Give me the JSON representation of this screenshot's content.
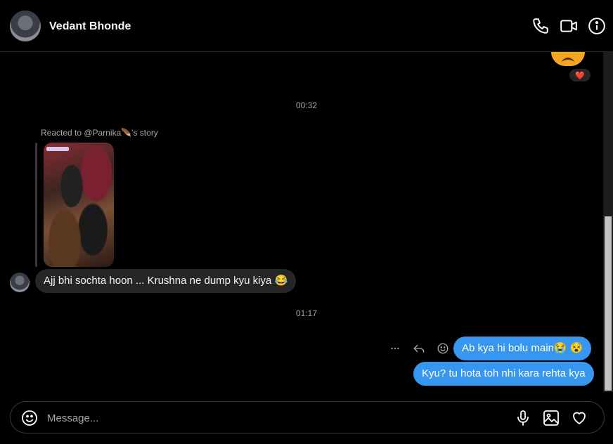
{
  "header": {
    "contact_name": "Vedant Bhonde",
    "icons": [
      "phone-icon",
      "video-camera-icon",
      "info-icon"
    ]
  },
  "thread": {
    "top_reaction": "❤️",
    "time_1": "00:32",
    "story_label": "Reacted to @Parnika🪶's story",
    "incoming_message": "Ajj bhi sochta hoon ... Krushna ne dump kyu kiya 😂",
    "time_2": "01:17",
    "outgoing_messages": [
      "Ab kya hi bolu main😭 😵",
      "Kyu? tu hota toh nhi kara rehta kya"
    ],
    "message_actions": [
      "more-icon",
      "reply-icon",
      "react-icon"
    ]
  },
  "composer": {
    "placeholder": "Message...",
    "icons": [
      "emoji-icon",
      "microphone-icon",
      "image-icon",
      "heart-icon"
    ]
  },
  "colors": {
    "background": "#000000",
    "incoming_bubble": "#262626",
    "outgoing_bubble": "#3797f0",
    "muted_text": "#a8a8a8"
  }
}
